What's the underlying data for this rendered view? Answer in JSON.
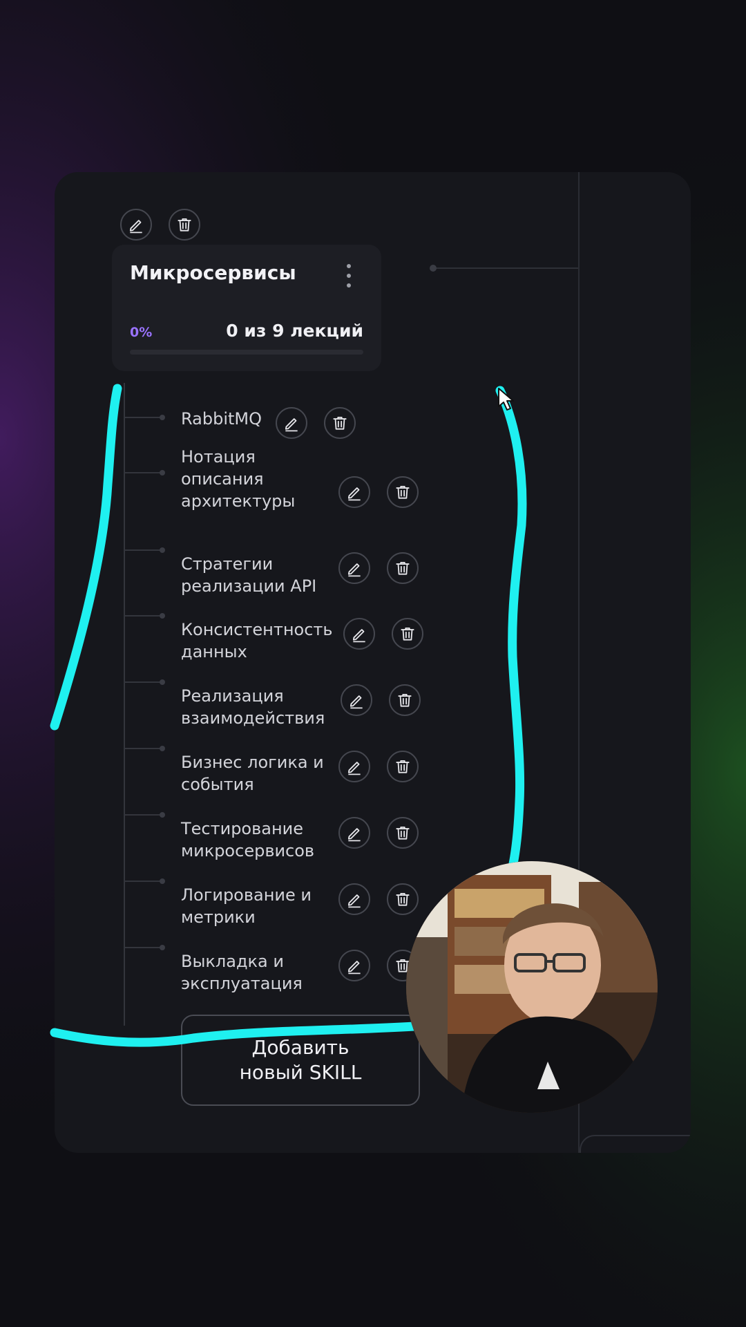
{
  "course": {
    "title": "Микросервисы",
    "progress_percent_label": "0%",
    "progress_fraction": 0,
    "progress_text": "0 из 9 лекций"
  },
  "lectures": [
    {
      "label": "RabbitMQ"
    },
    {
      "label": "Нотация описания архитектуры"
    },
    {
      "label": "Стратегии реализации API"
    },
    {
      "label": "Консистентность данных"
    },
    {
      "label": "Реализация взаимодействия"
    },
    {
      "label": "Бизнес логика и события"
    },
    {
      "label": "Тестирование микросервисов"
    },
    {
      "label": "Логирование и метрики"
    },
    {
      "label": "Выкладка и эксплуатация"
    }
  ],
  "add_button": {
    "label": "Добавить\nновый SKILL"
  },
  "icons": {
    "edit": "pencil-icon",
    "delete": "trash-icon",
    "menu": "kebab-menu-icon"
  },
  "colors": {
    "accent": "#9a73ff",
    "annotation": "#1ff0f0"
  }
}
